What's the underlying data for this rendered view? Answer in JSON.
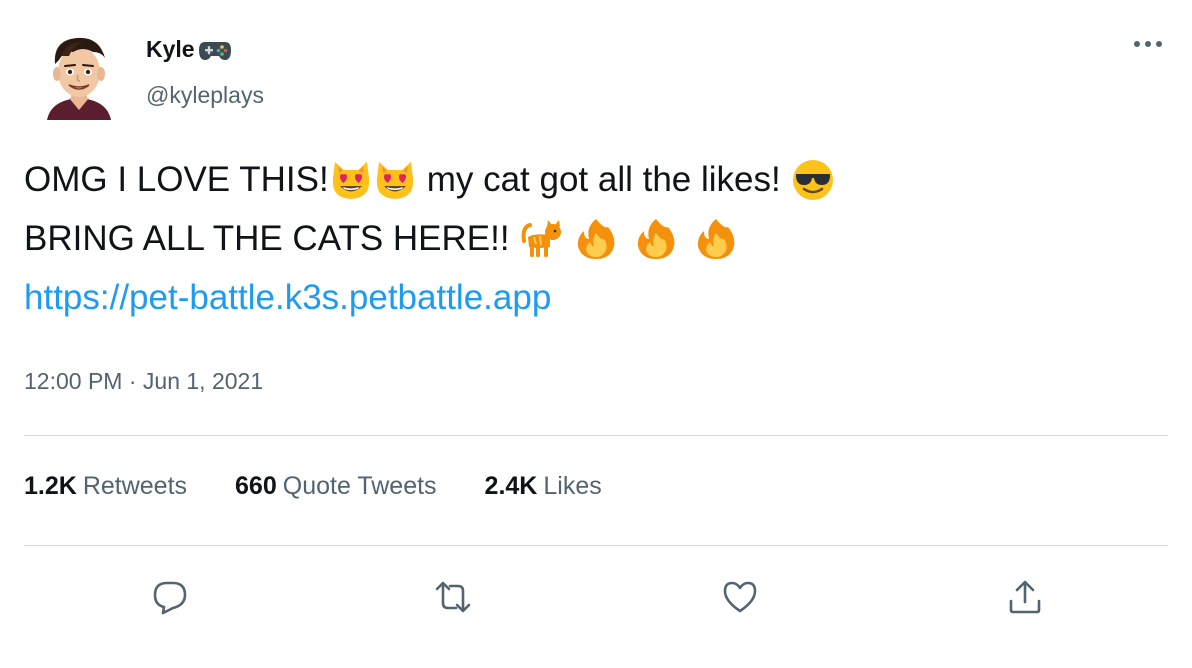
{
  "author": {
    "display_name": "Kyle",
    "badge_icon": "gamepad-icon",
    "handle": "@kyleplays"
  },
  "tweet": {
    "line1_a": "OMG I LOVE THIS!",
    "line1_b": "my cat got all the likes!",
    "line2_a": "BRING ALL THE CATS HERE!!",
    "link": "https://pet-battle.k3s.petbattle.app",
    "emojis": [
      "heart-eyes-cat-emoji",
      "heart-eyes-cat-emoji",
      "sunglasses-emoji",
      "cat-emoji",
      "fire-emoji",
      "fire-emoji",
      "fire-emoji"
    ]
  },
  "timestamp": {
    "time": "12:00 PM",
    "separator": "·",
    "date": "Jun 1, 2021"
  },
  "stats": {
    "retweets_count": "1.2K",
    "retweets_label": "Retweets",
    "quotes_count": "660",
    "quotes_label": "Quote Tweets",
    "likes_count": "2.4K",
    "likes_label": "Likes"
  },
  "colors": {
    "text": "#0f1419",
    "secondary": "#536471",
    "link": "#1d9bf0",
    "divider": "#cfd9de"
  }
}
